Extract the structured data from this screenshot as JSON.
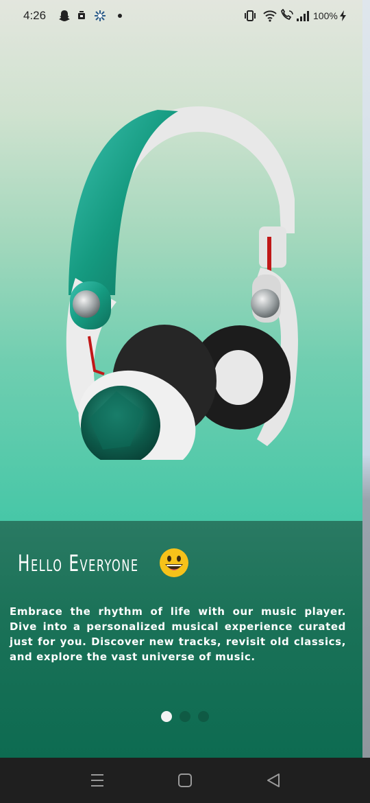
{
  "status_bar": {
    "time": "4:26",
    "battery": "100%",
    "icons": [
      "snapchat-icon",
      "notification-icon",
      "settings-icon",
      "dot-icon",
      "vibrate-icon",
      "wifi-icon",
      "wifi-call-icon",
      "signal-icon",
      "charging-icon"
    ]
  },
  "hero": {
    "image": "headphones-illustration"
  },
  "onboarding": {
    "title": "Hello Everyone",
    "emoji": "grinning-face-emoji",
    "description": "Embrace the rhythm of life with our music player. Dive into a personalized musical experience curated just for you. Discover new tracks, revisit old classics, and explore the vast universe of music.",
    "page_indicator": {
      "count": 3,
      "active": 0
    }
  },
  "nav": {
    "buttons": [
      "recent-apps-icon",
      "home-icon",
      "back-icon"
    ]
  },
  "colors": {
    "panel": "#1b7258",
    "dot_active": "#f2f2f2",
    "dot_inactive": "#0f5a44"
  }
}
